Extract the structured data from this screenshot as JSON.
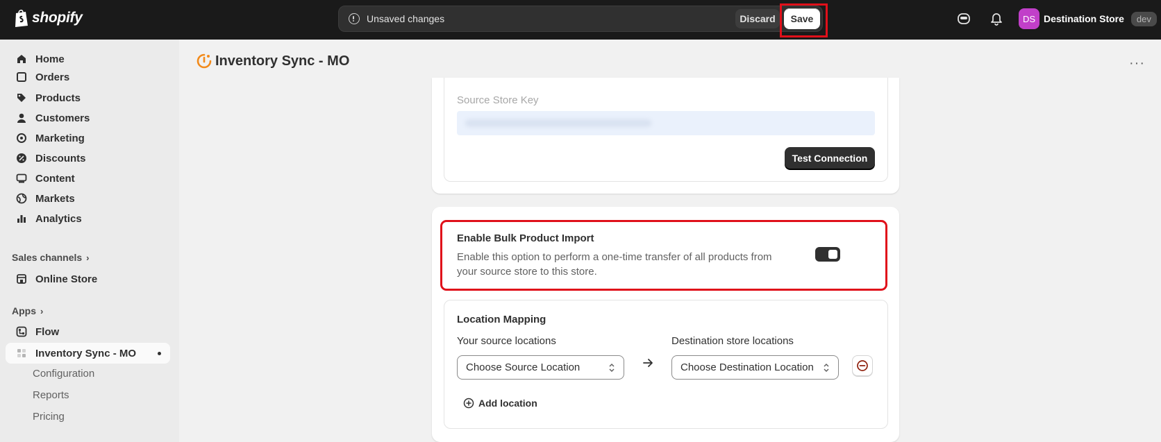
{
  "topbar": {
    "brand": "shopify",
    "unsaved_message": "Unsaved changes",
    "discard_label": "Discard",
    "save_label": "Save",
    "avatar_initials": "DS",
    "store_name": "Destination Store",
    "env_badge": "dev"
  },
  "sidebar": {
    "items": [
      {
        "label": "Home",
        "icon": "home-icon"
      },
      {
        "label": "Orders",
        "icon": "orders-icon"
      },
      {
        "label": "Products",
        "icon": "tag-icon"
      },
      {
        "label": "Customers",
        "icon": "person-icon"
      },
      {
        "label": "Marketing",
        "icon": "target-icon"
      },
      {
        "label": "Discounts",
        "icon": "discount-icon"
      },
      {
        "label": "Content",
        "icon": "content-icon"
      },
      {
        "label": "Markets",
        "icon": "globe-icon"
      },
      {
        "label": "Analytics",
        "icon": "bar-chart-icon"
      }
    ],
    "sales_channels_label": "Sales channels",
    "online_store_label": "Online Store",
    "apps_label": "Apps",
    "flow_label": "Flow",
    "app_active_label": "Inventory Sync - MO",
    "app_subitems": [
      "Configuration",
      "Reports",
      "Pricing"
    ]
  },
  "page": {
    "title": "Inventory Sync - MO"
  },
  "connection": {
    "source_key_label": "Source Store Key",
    "test_button": "Test Connection"
  },
  "bulk_import": {
    "title": "Enable Bulk Product Import",
    "description": "Enable this option to perform a one-time transfer of all products from your source store to this store.",
    "enabled": true
  },
  "location_mapping": {
    "title": "Location Mapping",
    "source_label": "Your source locations",
    "destination_label": "Destination store locations",
    "source_select": "Choose Source Location",
    "destination_select": "Choose Destination Location",
    "add_location": "Add location"
  },
  "colors": {
    "highlight": "#e0101a",
    "topbar": "#1a1a1a",
    "avatar": "#c13fc9",
    "remove": "#8e1f0b"
  }
}
